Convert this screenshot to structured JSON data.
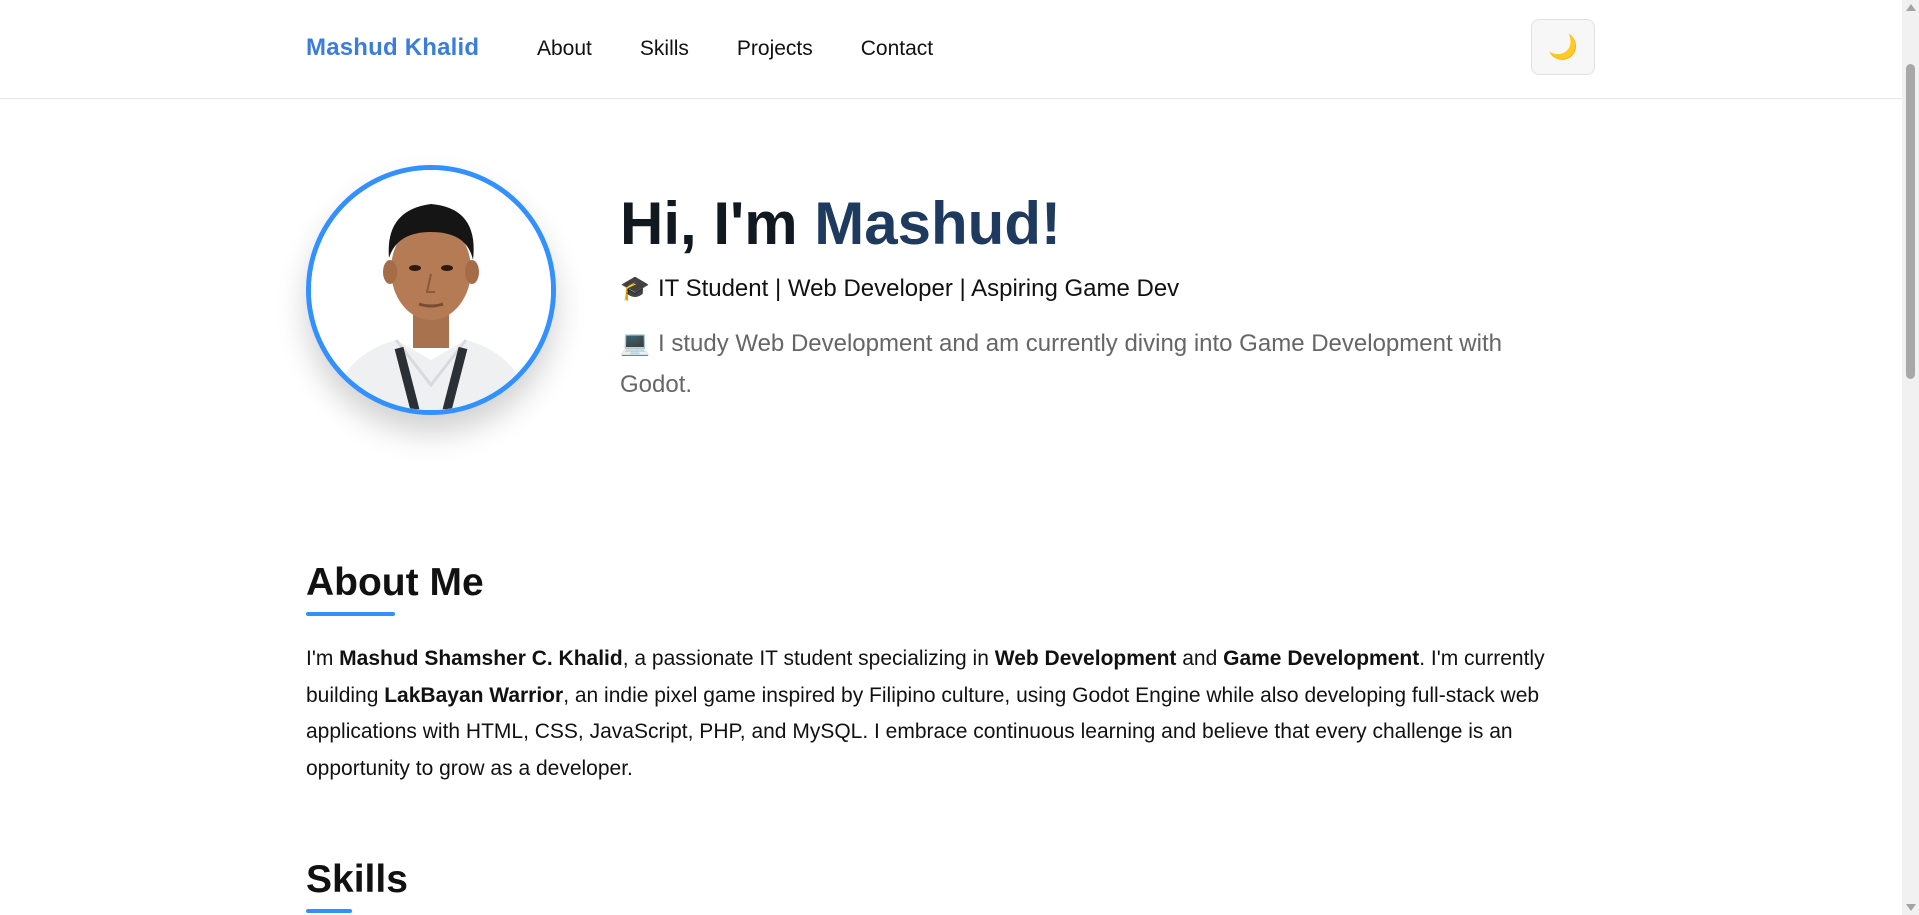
{
  "navbar": {
    "brand": "Mashud Khalid",
    "links": [
      "About",
      "Skills",
      "Projects",
      "Contact"
    ],
    "theme_toggle_icon": "moon-icon",
    "theme_toggle_glyph": "🌙"
  },
  "hero": {
    "title_prefix": "Hi, I'm ",
    "title_name": "Mashud!",
    "subtitle_icon": "graduation-cap-icon",
    "subtitle_glyph": "🎓",
    "subtitle": "IT Student | Web Developer | Aspiring Game Dev",
    "desc_icon": "laptop-icon",
    "desc_glyph": "💻",
    "description": "I study Web Development and am currently diving into Game Development with Godot."
  },
  "about": {
    "title": "About Me",
    "text_1": "I'm ",
    "name": "Mashud Shamsher C. Khalid",
    "text_2": ", a passionate IT student specializing in ",
    "skill_1": "Web Development",
    "text_3": " and ",
    "skill_2": "Game Development",
    "text_4": ". I'm currently building ",
    "project": "LakBayan Warrior",
    "text_5": ", an indie pixel game inspired by Filipino culture, using Godot Engine while also developing full-stack web applications with HTML, CSS, JavaScript, PHP, and MySQL. I embrace continuous learning and believe that every challenge is an opportunity to grow as a developer."
  },
  "skills": {
    "title": "Skills"
  },
  "colors": {
    "accent": "#3391ff",
    "brand": "#3b7ddd",
    "name_highlight": "#1e3a5f"
  }
}
